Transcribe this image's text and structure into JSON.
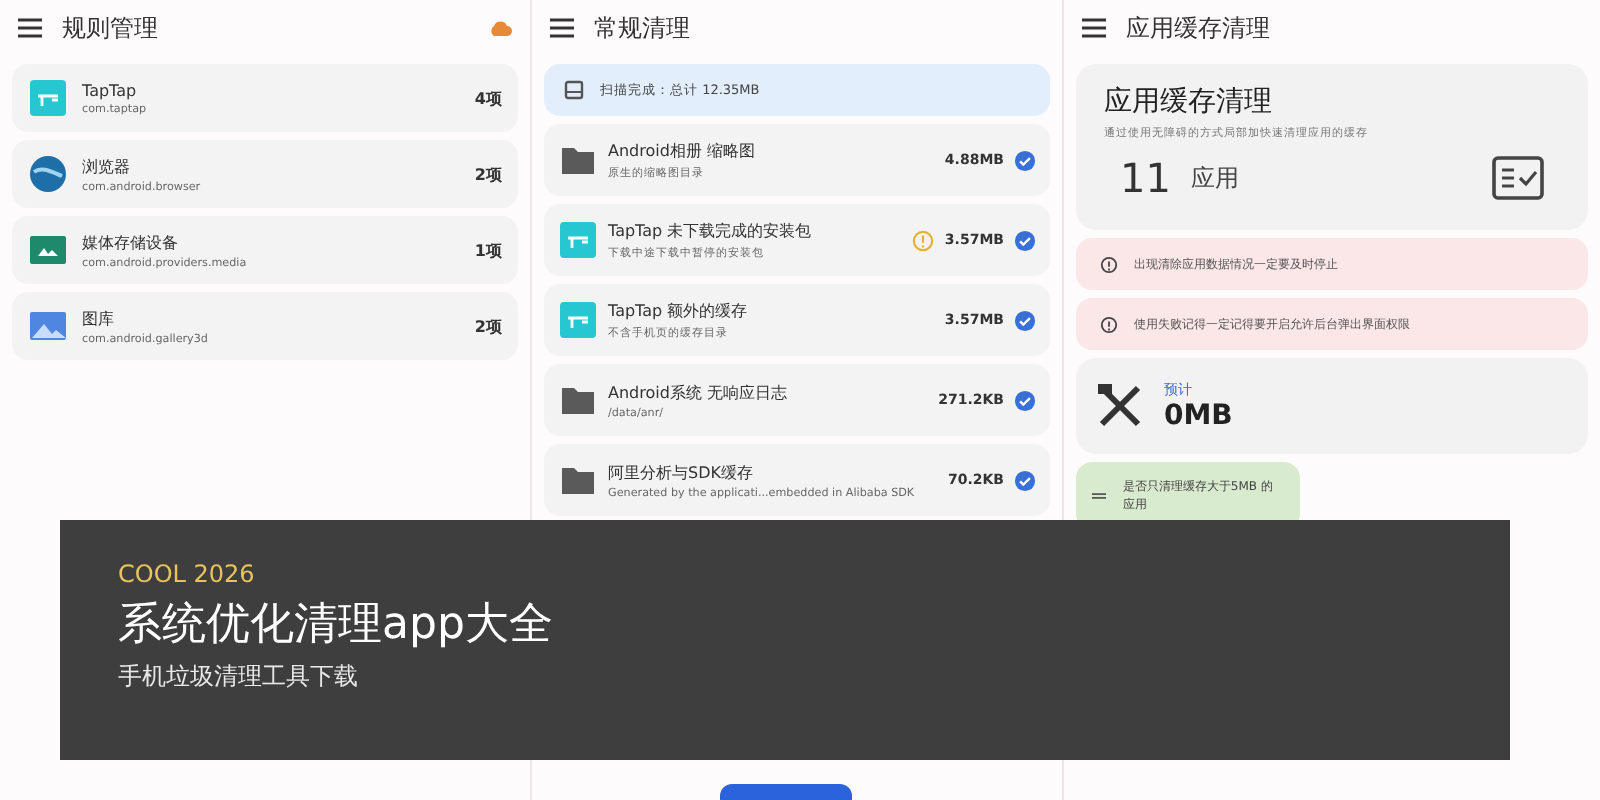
{
  "rules_panel": {
    "title": "规则管理",
    "items": [
      {
        "name": "TapTap",
        "package": "com.taptap",
        "count": "4项",
        "kind": "taptap"
      },
      {
        "name": "浏览器",
        "package": "com.android.browser",
        "count": "2项",
        "kind": "globe"
      },
      {
        "name": "媒体存储设备",
        "package": "com.android.providers.media",
        "count": "1项",
        "kind": "media"
      },
      {
        "name": "图库",
        "package": "com.android.gallery3d",
        "count": "2项",
        "kind": "gallery"
      }
    ]
  },
  "clean_panel": {
    "title": "常规清理",
    "scan_status": "扫描完成：总计 12.35MB",
    "items": [
      {
        "name": "Android相册 缩略图",
        "detail": "原生的缩略图目录",
        "size": "4.88MB",
        "kind": "folder",
        "warning": false,
        "checked": true
      },
      {
        "name": "TapTap 未下载完成的安装包",
        "detail": "下载中途下载中暂停的安装包",
        "size": "3.57MB",
        "kind": "taptap",
        "warning": true,
        "checked": true
      },
      {
        "name": "TapTap 额外的缓存",
        "detail": "不含手机页的缓存目录",
        "size": "3.57MB",
        "kind": "taptap",
        "warning": false,
        "checked": true
      },
      {
        "name": "Android系统 无响应日志",
        "detail": "/data/anr/",
        "size": "271.2KB",
        "kind": "folder",
        "warning": false,
        "checked": true
      },
      {
        "name": "阿里分析与SDK缓存",
        "detail": "Generated by the applicati...embedded in Alibaba SDK",
        "size": "70.2KB",
        "kind": "folder",
        "warning": false,
        "checked": true
      }
    ]
  },
  "cache_panel": {
    "title": "应用缓存清理",
    "card_title": "应用缓存清理",
    "card_subtitle": "通过使用无障碍的方式局部加快速清理应用的缓存",
    "app_count": "11",
    "app_unit": "应用",
    "alerts": [
      "出现清除应用数据情况一定要及时停止",
      "使用失败记得一定记得要开启允许后台弹出界面权限"
    ],
    "estimate_label": "预计",
    "estimate_value": "0MB",
    "filter_option": "是否只清理缓存大于5MB 的应用"
  },
  "overlay": {
    "kicker": "COOL 2026",
    "headline": "系统优化清理app大全",
    "subtitle": "手机垃圾清理工具下载"
  }
}
